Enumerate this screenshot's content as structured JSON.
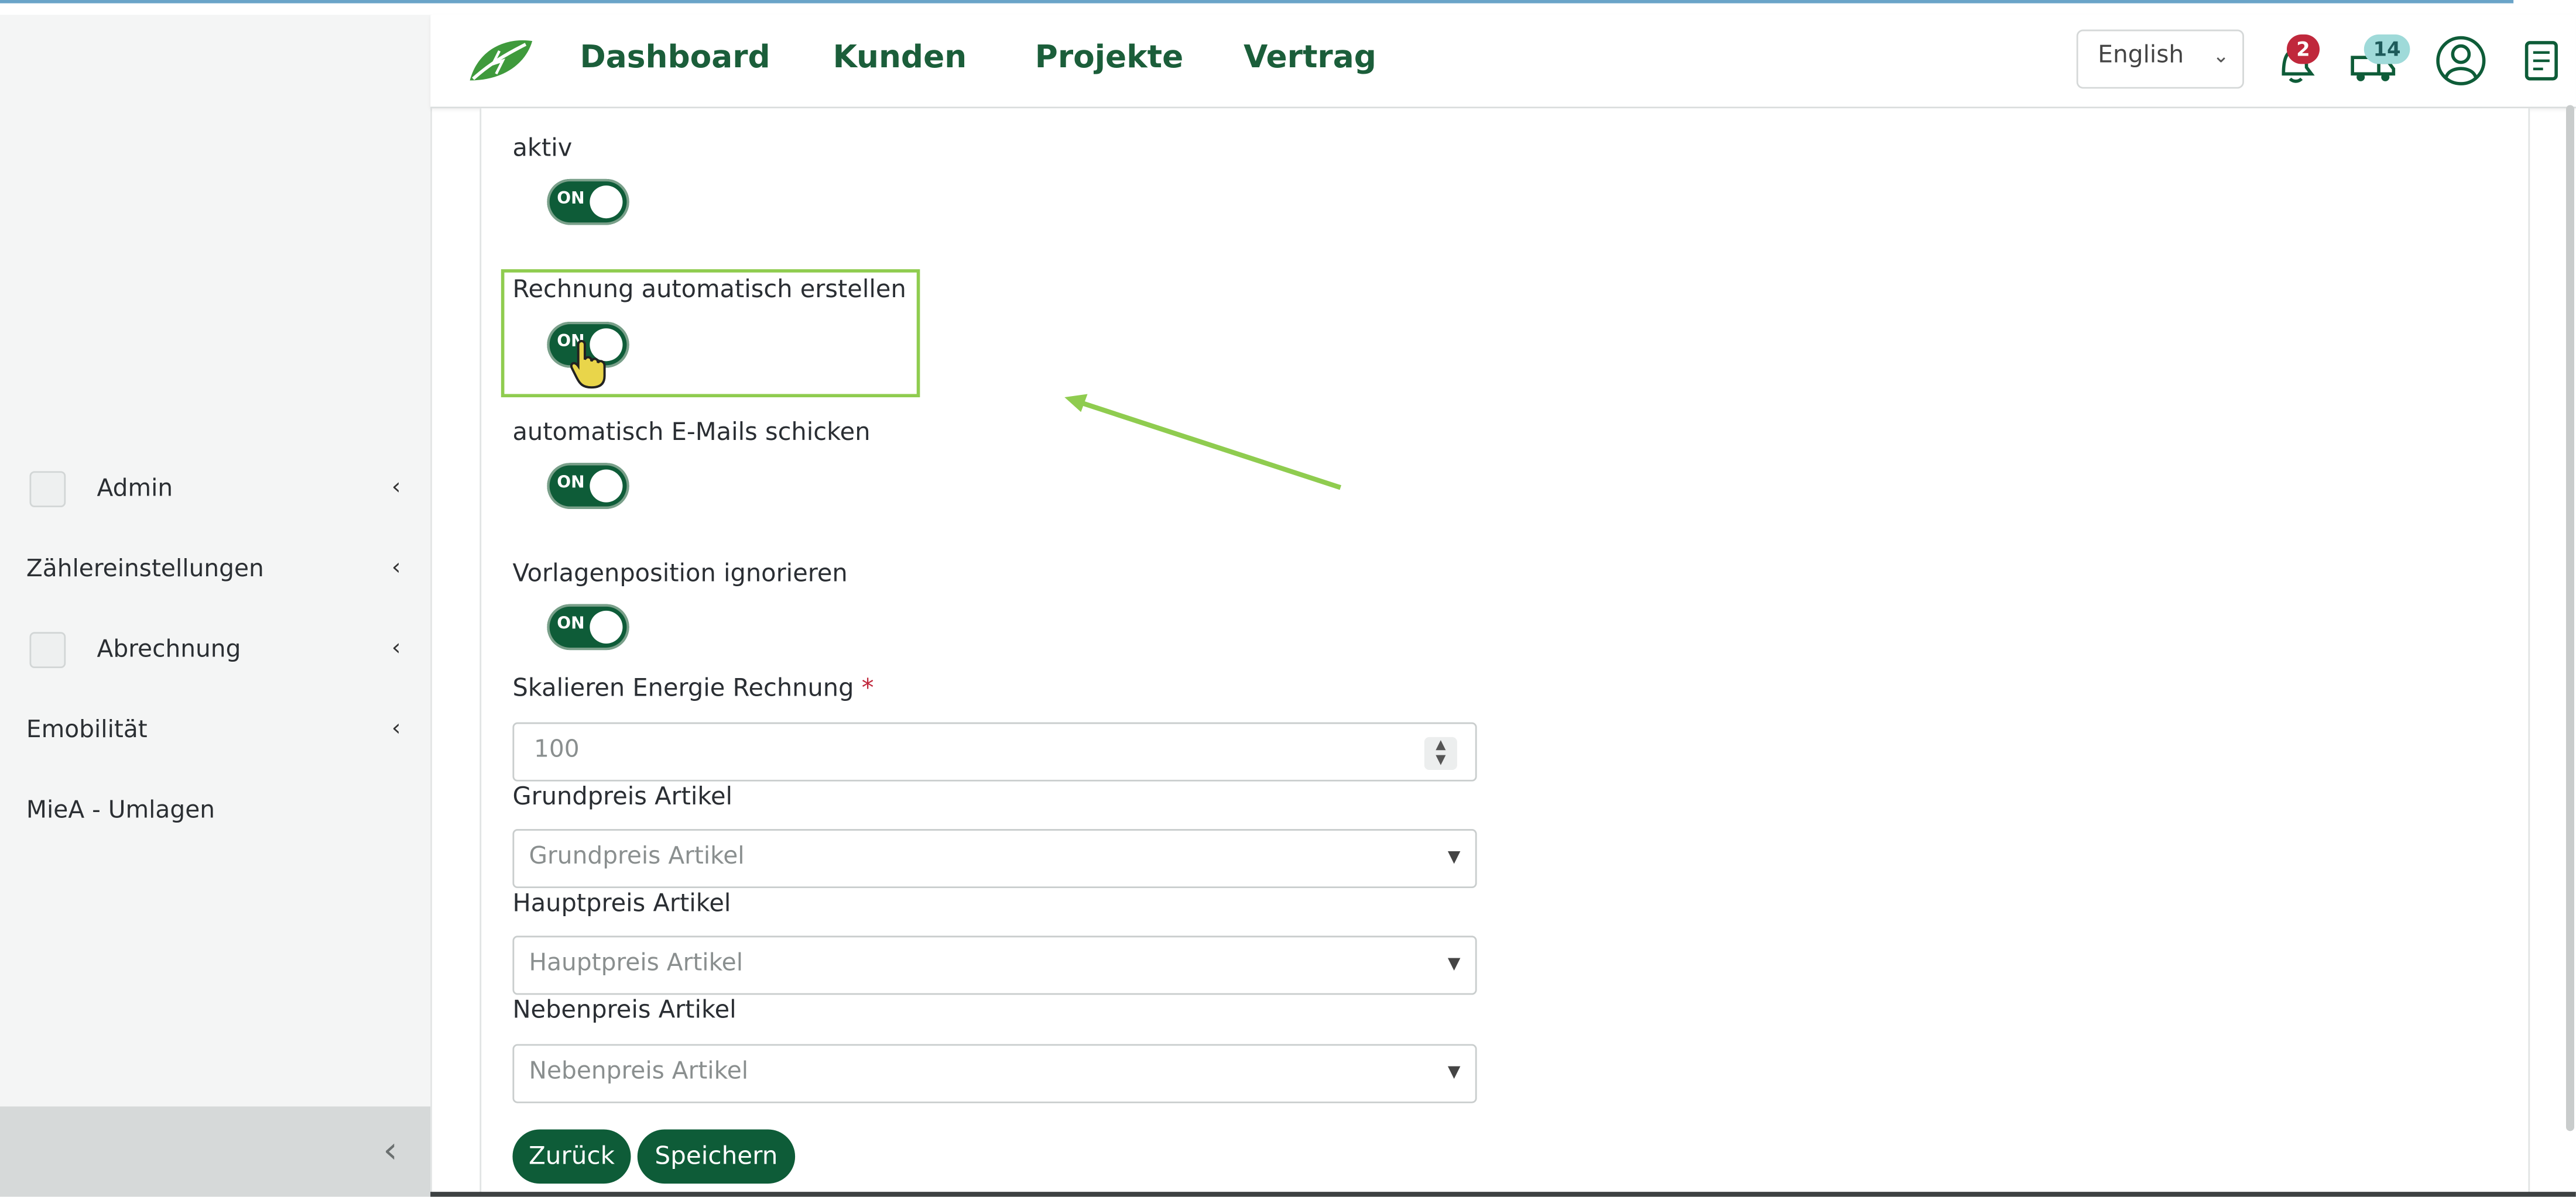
{
  "nav": {
    "links": [
      "Dashboard",
      "Kunden",
      "Projekte",
      "Vertrag"
    ],
    "language": "English",
    "notifications_count": "2",
    "messages_count": "14"
  },
  "sidebar": {
    "items": [
      {
        "label": "Admin",
        "icon": "admin-icon"
      },
      {
        "label": "Zählereinstellungen"
      },
      {
        "label": "Abrechnung",
        "icon": "billing-icon"
      },
      {
        "label": "Emobilität"
      },
      {
        "label": "MieA - Umlagen"
      }
    ]
  },
  "form": {
    "toggles": [
      {
        "label": "aktiv",
        "state": "ON"
      },
      {
        "label": "Rechnung automatisch erstellen",
        "state": "ON"
      },
      {
        "label": "automatisch E-Mails schicken",
        "state": "ON"
      },
      {
        "label": "Vorlagenposition ignorieren",
        "state": "ON"
      }
    ],
    "scale": {
      "label": "Skalieren Energie Rechnung",
      "required_marker": "*",
      "value": "100"
    },
    "selects": [
      {
        "label": "Grundpreis Artikel",
        "placeholder": "Grundpreis Artikel"
      },
      {
        "label": "Hauptpreis Artikel",
        "placeholder": "Hauptpreis Artikel"
      },
      {
        "label": "Nebenpreis Artikel",
        "placeholder": "Nebenpreis Artikel"
      }
    ],
    "buttons": {
      "back": "Zurück",
      "save": "Speichern"
    }
  },
  "colors": {
    "brand": "#0e5c38",
    "highlight": "#8fcc4f",
    "badge_red": "#c0283c",
    "badge_teal": "#9fdad9"
  }
}
